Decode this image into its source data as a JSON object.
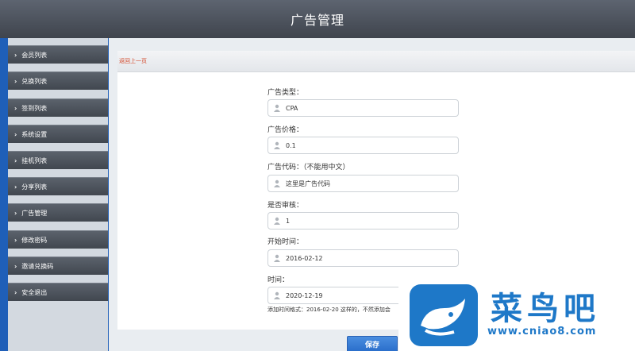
{
  "header": {
    "title": "广告管理"
  },
  "sidebar": {
    "items": [
      {
        "label": "会员列表"
      },
      {
        "label": "兑换列表"
      },
      {
        "label": "签到列表"
      },
      {
        "label": "系统设置"
      },
      {
        "label": "挂机列表"
      },
      {
        "label": "分享列表"
      },
      {
        "label": "广告管理"
      },
      {
        "label": "修改密码"
      },
      {
        "label": "邀请兑换码"
      },
      {
        "label": "安全退出"
      }
    ]
  },
  "main": {
    "back_label": "返回上一页",
    "fields": [
      {
        "label": "广告类型：",
        "value": "CPA"
      },
      {
        "label": "广告价格：",
        "value": "0.1"
      },
      {
        "label": "广告代码：（不能用中文）",
        "value": "这里是广告代码"
      },
      {
        "label": "是否审核：",
        "value": "1"
      },
      {
        "label": "开始时间：",
        "value": "2016-02-12"
      },
      {
        "label": "时间：",
        "value": "2020-12-19"
      }
    ],
    "hint": "添加时间格式：2016-02-20 这样的，不然添加会",
    "save_label": "保存"
  },
  "watermark": {
    "brand": "菜鸟吧",
    "url": "www.cniao8.com"
  },
  "colors": {
    "accent": "#1f5fb8",
    "link": "#d34a2c",
    "brand": "#1e78c8"
  }
}
